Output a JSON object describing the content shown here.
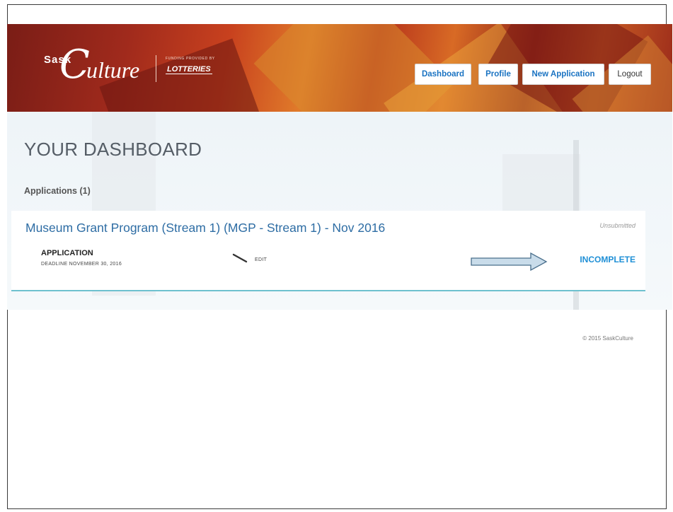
{
  "header": {
    "logo": {
      "sask": "Sask",
      "c_letter": "C",
      "word": "ulture",
      "funding_text": "FUNDING PROVIDED BY",
      "lotteries": "LOTTERIES"
    },
    "nav": {
      "dashboard": "Dashboard",
      "profile": "Profile",
      "new_application": "New Application",
      "logout": "Logout"
    },
    "colors": {
      "brand_red": "#a02a1c",
      "brand_orange": "#e07a2a",
      "link_blue": "#1a73c2"
    }
  },
  "main": {
    "page_title": "YOUR DASHBOARD",
    "applications_heading": "Applications (1)",
    "applications": [
      {
        "title": "Museum Grant Program (Stream 1) (MGP - Stream 1) - Nov 2016",
        "status": "Unsubmitted",
        "label": "APPLICATION",
        "deadline": "DEADLINE NOVEMBER 30, 2016",
        "edit_label": "EDIT",
        "progress_status": "INCOMPLETE"
      }
    ]
  },
  "footer": {
    "copyright": "© 2015 SaskCulture"
  },
  "icons": {
    "edit": "pencil-icon",
    "arrow": "right-arrow-annotation"
  }
}
